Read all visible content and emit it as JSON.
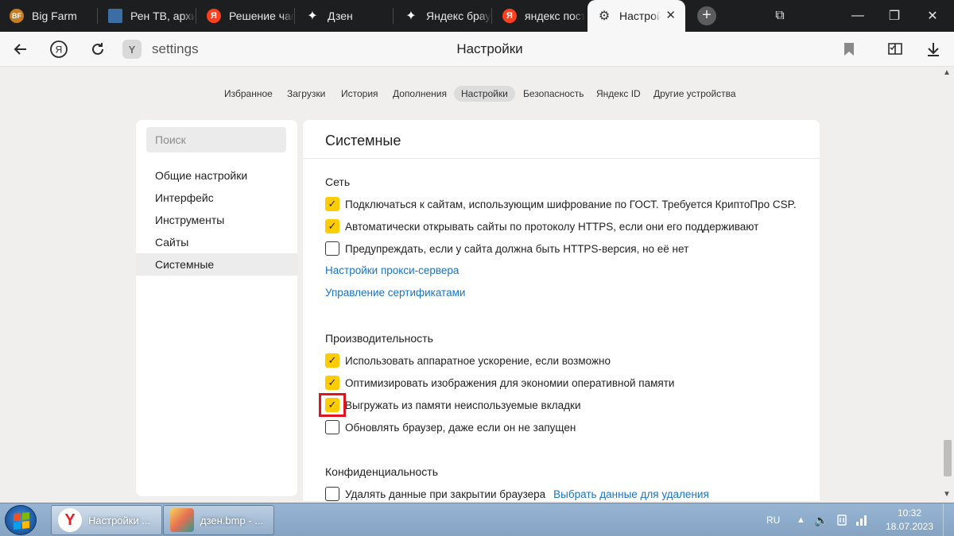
{
  "tabs": [
    {
      "title": "Big Farm",
      "icon": "bigfarm-icon",
      "badge": "BF",
      "color": "#c77d1f"
    },
    {
      "title": "Рен ТВ, архив",
      "icon": "rentv-icon",
      "badge": "",
      "color": "#3a6ea5"
    },
    {
      "title": "Решение частых",
      "icon": "yandex-icon",
      "badge": "Я",
      "color": "#fc3f1d"
    },
    {
      "title": "Дзен",
      "icon": "dzen-icon",
      "badge": "✦",
      "color": "#1d1e20"
    },
    {
      "title": "Яндекс браузер",
      "icon": "dzen-icon",
      "badge": "✦",
      "color": "#1d1e20"
    },
    {
      "title": "яндекс поставить",
      "icon": "yandex-icon",
      "badge": "Я",
      "color": "#fc3f1d"
    }
  ],
  "active_tab": {
    "title": "Настройки",
    "close": "✕"
  },
  "window_controls": {
    "collections": "⧉",
    "minimize": "—",
    "restore": "❐",
    "close": "✕"
  },
  "address_bar": {
    "url": "settings",
    "title": "Настройки",
    "site_badge": "Y"
  },
  "settings_nav": [
    {
      "label": "Избранное"
    },
    {
      "label": "Загрузки"
    },
    {
      "label": "История"
    },
    {
      "label": "Дополнения"
    },
    {
      "label": "Настройки"
    },
    {
      "label": "Безопасность"
    },
    {
      "label": "Яндекс ID"
    },
    {
      "label": "Другие устройства"
    }
  ],
  "sidebar": {
    "search_placeholder": "Поиск",
    "items": [
      {
        "label": "Общие настройки"
      },
      {
        "label": "Интерфейс"
      },
      {
        "label": "Инструменты"
      },
      {
        "label": "Сайты"
      },
      {
        "label": "Системные",
        "active": true
      }
    ]
  },
  "main": {
    "title": "Системные",
    "sections": {
      "network": {
        "heading": "Сеть",
        "options": [
          {
            "label": "Подключаться к сайтам, использующим шифрование по ГОСТ. Требуется КриптоПро CSP.",
            "checked": true
          },
          {
            "label": "Автоматически открывать сайты по протоколу HTTPS, если они его поддерживают",
            "checked": true
          },
          {
            "label": "Предупреждать, если у сайта должна быть HTTPS-версия, но её нет",
            "checked": false
          }
        ],
        "links": [
          "Настройки прокси-сервера",
          "Управление сертификатами"
        ]
      },
      "performance": {
        "heading": "Производительность",
        "options": [
          {
            "label": "Использовать аппаратное ускорение, если возможно",
            "checked": true
          },
          {
            "label": "Оптимизировать изображения для экономии оперативной памяти",
            "checked": true
          },
          {
            "label": "Выгружать из памяти неиспользуемые вкладки",
            "checked": true,
            "highlighted": true
          },
          {
            "label": "Обновлять браузер, даже если он не запущен",
            "checked": false
          }
        ]
      },
      "privacy": {
        "heading": "Конфиденциальность",
        "options": [
          {
            "label": "Удалять данные при закрытии браузера",
            "checked": false,
            "link": "Выбрать данные для удаления"
          }
        ]
      }
    },
    "check_glyph": "✓",
    "highlight_color": "#e0141e",
    "checkbox_color": "#ffcc00",
    "link_color": "#1a73c7"
  },
  "taskbar": {
    "buttons": [
      {
        "label": "Настройки ...",
        "icon": "yandex-browser-icon",
        "active": true
      },
      {
        "label": "дзен.bmp - ...",
        "icon": "paint-icon",
        "active": false
      }
    ],
    "language": "RU",
    "time": "10:32",
    "date": "18.07.2023"
  }
}
